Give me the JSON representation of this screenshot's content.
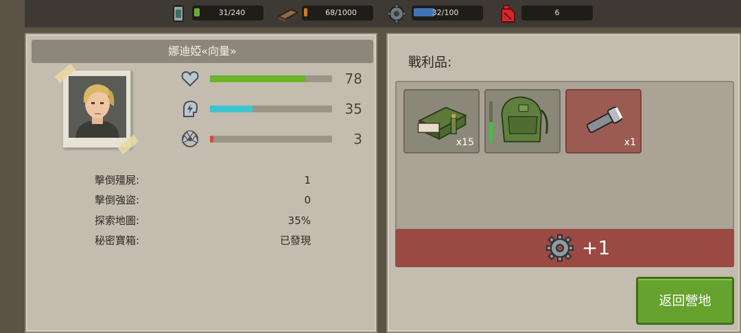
{
  "resources": [
    {
      "icon": "battery-icon",
      "text": "31/240",
      "bar_color": "#6ea83a"
    },
    {
      "icon": "wood-plank-icon",
      "text": "68/1000",
      "bar_color": "#d47a1f"
    },
    {
      "icon": "gear-icon",
      "text": "32/100",
      "bar_color": "#3f73b8"
    },
    {
      "icon": "fuel-can-icon",
      "text": "6"
    }
  ],
  "character": {
    "name": "娜迪婭«向量»",
    "stats": [
      {
        "icon": "heart-icon",
        "value": "78",
        "fraction": 0.78,
        "color": "#6bb52a"
      },
      {
        "icon": "energy-head-icon",
        "value": "35",
        "fraction": 0.35,
        "color": "#3ec4cf"
      },
      {
        "icon": "radiation-icon",
        "value": "3",
        "fraction": 0.03,
        "color": "#d84a3a"
      }
    ],
    "summary": [
      {
        "label": "擊倒殭屍:",
        "value": "1"
      },
      {
        "label": "擊倒強盜:",
        "value": "0"
      },
      {
        "label": "探索地圖:",
        "value": "35%"
      },
      {
        "label": "秘密寶箱:",
        "value": "已發現"
      }
    ]
  },
  "loot": {
    "title": "戰利品:",
    "items": [
      {
        "icon": "ammo-box-icon",
        "count": "x15",
        "highlight": false
      },
      {
        "icon": "backpack-icon",
        "count": "",
        "highlight": false
      },
      {
        "icon": "flashlight-icon",
        "count": "x1",
        "highlight": true
      }
    ],
    "reward": {
      "icon": "gear-icon",
      "amount": "+1"
    }
  },
  "return_button": "返回營地",
  "colors": {
    "panel": "#c3bcaf",
    "reward_bar": "#9a4a43",
    "button": "#66a22e"
  }
}
